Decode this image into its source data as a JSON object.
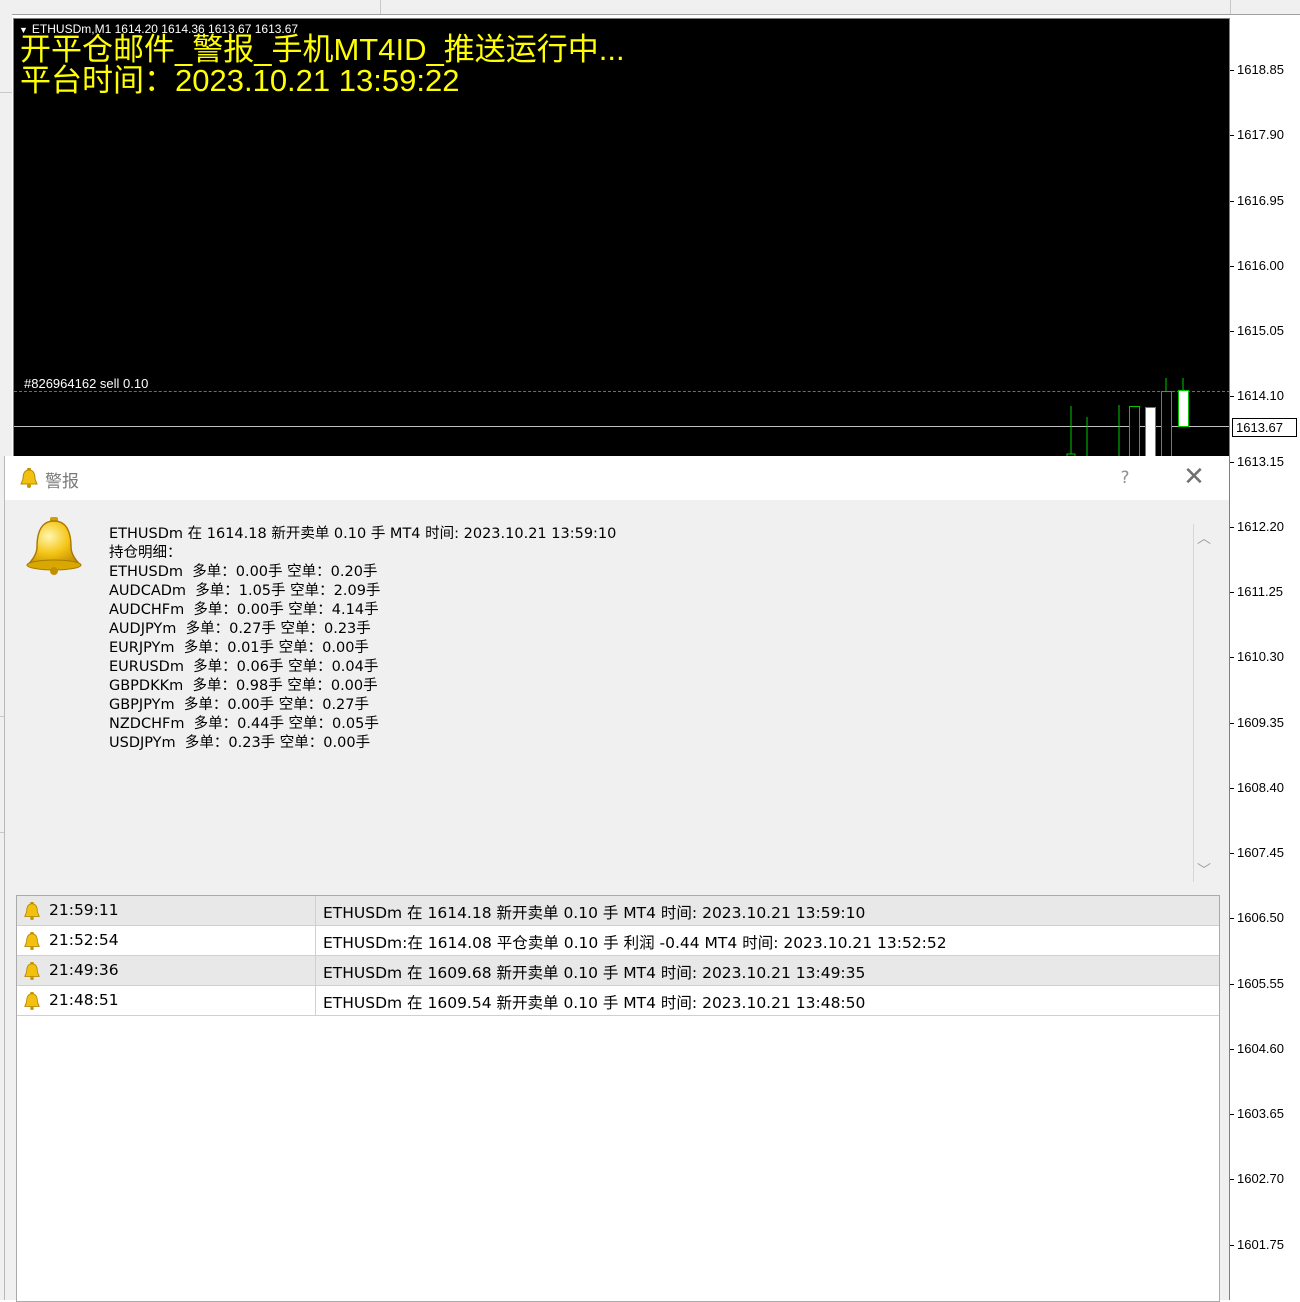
{
  "chart": {
    "header": "ETHUSDm,M1  1614.20 1614.36 1613.67 1613.67",
    "ea_status": "开平仓邮件_警报_手机MT4ID_推送运行中...",
    "platform_time": "平台时间：2023.10.21 13:59:22",
    "order_label": "#826964162 sell 0.10",
    "current_price": "1613.67",
    "price_axis": [
      "1618.85",
      "1617.90",
      "1616.95",
      "1616.00",
      "1615.05",
      "1614.10",
      "1613.15",
      "1612.20",
      "1611.25",
      "1610.30",
      "1609.35",
      "1608.40",
      "1607.45",
      "1606.50",
      "1605.55",
      "1604.60",
      "1603.65",
      "1602.70",
      "1601.75"
    ],
    "colors": {
      "background": "#000000",
      "text": "#ffff00",
      "candle": "#00c800",
      "order_line": "#1fa41f"
    }
  },
  "dialog": {
    "title": "警报",
    "help_label": "?",
    "close_label": "✕",
    "message_lines": [
      "ETHUSDm 在 1614.18 新开卖单 0.10 手 MT4 时间: 2023.10.21 13:59:10",
      "持仓明细：",
      "ETHUSDm  多单：0.00手 空单：0.20手",
      "AUDCADm  多单：1.05手 空单：2.09手",
      "AUDCHFm  多单：0.00手 空单：4.14手",
      "AUDJPYm  多单：0.27手 空单：0.23手",
      "EURJPYm  多单：0.01手 空单：0.00手",
      "EURUSDm  多单：0.06手 空单：0.04手",
      "GBPDKKm  多单：0.98手 空单：0.00手",
      "GBPJPYm  多单：0.00手 空单：0.27手",
      "NZDCHFm  多单：0.44手 空单：0.05手",
      "USDJPYm  多单：0.23手 空单：0.00手"
    ],
    "alerts": [
      {
        "time": "21:59:11",
        "message": "ETHUSDm 在 1614.18 新开卖单 0.10 手 MT4 时间: 2023.10.21 13:59:10"
      },
      {
        "time": "21:52:54",
        "message": "ETHUSDm:在 1614.08 平仓卖单 0.10 手 利润 -0.44 MT4 时间: 2023.10.21 13:52:52"
      },
      {
        "time": "21:49:36",
        "message": "ETHUSDm 在 1609.68 新开卖单 0.10 手 MT4 时间: 2023.10.21 13:49:35"
      },
      {
        "time": "21:48:51",
        "message": "ETHUSDm 在 1609.54 新开卖单 0.10 手 MT4 时间: 2023.10.21 13:48:50"
      }
    ]
  }
}
